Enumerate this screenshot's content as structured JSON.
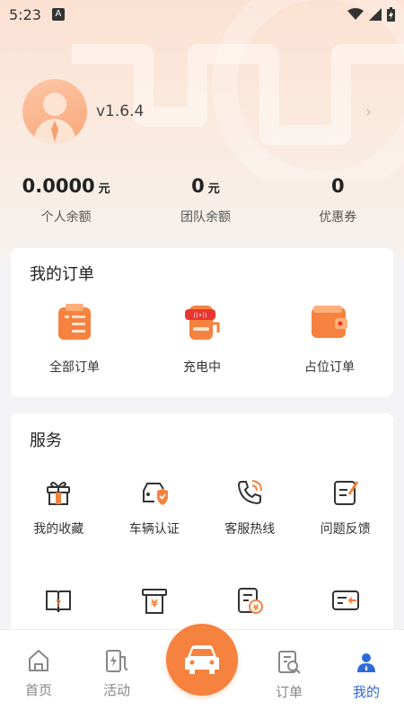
{
  "status_bar": {
    "time": "5:23",
    "indicator": "A"
  },
  "profile": {
    "version": "v1.6.4"
  },
  "balances": [
    {
      "value": "0.0000",
      "unit": "元",
      "label": "个人余额"
    },
    {
      "value": "0",
      "unit": "元",
      "label": "团队余额"
    },
    {
      "value": "0",
      "unit": "",
      "label": "优惠券"
    }
  ],
  "orders": {
    "title": "我的订单",
    "items": [
      {
        "label": "全部订单",
        "icon": "clipboard-list-icon"
      },
      {
        "label": "充电中",
        "icon": "charging-station-icon"
      },
      {
        "label": "占位订单",
        "icon": "wallet-icon"
      }
    ]
  },
  "services": {
    "title": "服务",
    "row1": [
      {
        "label": "我的收藏",
        "icon": "gift-icon"
      },
      {
        "label": "车辆认证",
        "icon": "car-shield-icon"
      },
      {
        "label": "客服热线",
        "icon": "phone-icon"
      },
      {
        "label": "问题反馈",
        "icon": "feedback-icon"
      }
    ]
  },
  "tabbar": {
    "items": [
      {
        "label": "首页",
        "icon": "home-icon"
      },
      {
        "label": "活动",
        "icon": "charger-icon"
      },
      {
        "label": "订单",
        "icon": "order-search-icon"
      },
      {
        "label": "我的",
        "icon": "user-icon"
      }
    ],
    "active": "我的",
    "center_icon": "car-icon"
  },
  "colors": {
    "accent": "#f5823f",
    "active_tab": "#2d6ad9",
    "hero_bg": "#fbe1d2"
  }
}
